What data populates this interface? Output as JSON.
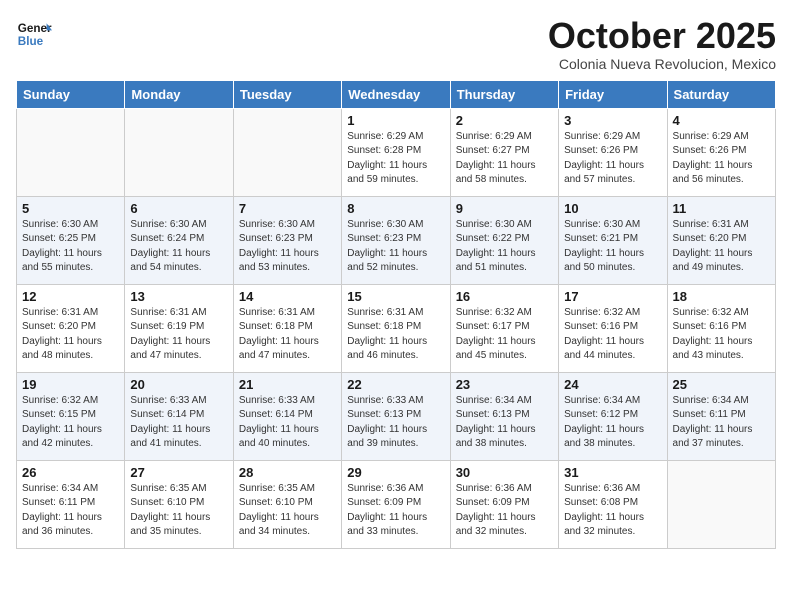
{
  "logo": {
    "line1": "General",
    "line2": "Blue"
  },
  "title": "October 2025",
  "subtitle": "Colonia Nueva Revolucion, Mexico",
  "days_of_week": [
    "Sunday",
    "Monday",
    "Tuesday",
    "Wednesday",
    "Thursday",
    "Friday",
    "Saturday"
  ],
  "weeks": [
    [
      {
        "day": "",
        "info": ""
      },
      {
        "day": "",
        "info": ""
      },
      {
        "day": "",
        "info": ""
      },
      {
        "day": "1",
        "info": "Sunrise: 6:29 AM\nSunset: 6:28 PM\nDaylight: 11 hours and 59 minutes."
      },
      {
        "day": "2",
        "info": "Sunrise: 6:29 AM\nSunset: 6:27 PM\nDaylight: 11 hours and 58 minutes."
      },
      {
        "day": "3",
        "info": "Sunrise: 6:29 AM\nSunset: 6:26 PM\nDaylight: 11 hours and 57 minutes."
      },
      {
        "day": "4",
        "info": "Sunrise: 6:29 AM\nSunset: 6:26 PM\nDaylight: 11 hours and 56 minutes."
      }
    ],
    [
      {
        "day": "5",
        "info": "Sunrise: 6:30 AM\nSunset: 6:25 PM\nDaylight: 11 hours and 55 minutes."
      },
      {
        "day": "6",
        "info": "Sunrise: 6:30 AM\nSunset: 6:24 PM\nDaylight: 11 hours and 54 minutes."
      },
      {
        "day": "7",
        "info": "Sunrise: 6:30 AM\nSunset: 6:23 PM\nDaylight: 11 hours and 53 minutes."
      },
      {
        "day": "8",
        "info": "Sunrise: 6:30 AM\nSunset: 6:23 PM\nDaylight: 11 hours and 52 minutes."
      },
      {
        "day": "9",
        "info": "Sunrise: 6:30 AM\nSunset: 6:22 PM\nDaylight: 11 hours and 51 minutes."
      },
      {
        "day": "10",
        "info": "Sunrise: 6:30 AM\nSunset: 6:21 PM\nDaylight: 11 hours and 50 minutes."
      },
      {
        "day": "11",
        "info": "Sunrise: 6:31 AM\nSunset: 6:20 PM\nDaylight: 11 hours and 49 minutes."
      }
    ],
    [
      {
        "day": "12",
        "info": "Sunrise: 6:31 AM\nSunset: 6:20 PM\nDaylight: 11 hours and 48 minutes."
      },
      {
        "day": "13",
        "info": "Sunrise: 6:31 AM\nSunset: 6:19 PM\nDaylight: 11 hours and 47 minutes."
      },
      {
        "day": "14",
        "info": "Sunrise: 6:31 AM\nSunset: 6:18 PM\nDaylight: 11 hours and 47 minutes."
      },
      {
        "day": "15",
        "info": "Sunrise: 6:31 AM\nSunset: 6:18 PM\nDaylight: 11 hours and 46 minutes."
      },
      {
        "day": "16",
        "info": "Sunrise: 6:32 AM\nSunset: 6:17 PM\nDaylight: 11 hours and 45 minutes."
      },
      {
        "day": "17",
        "info": "Sunrise: 6:32 AM\nSunset: 6:16 PM\nDaylight: 11 hours and 44 minutes."
      },
      {
        "day": "18",
        "info": "Sunrise: 6:32 AM\nSunset: 6:16 PM\nDaylight: 11 hours and 43 minutes."
      }
    ],
    [
      {
        "day": "19",
        "info": "Sunrise: 6:32 AM\nSunset: 6:15 PM\nDaylight: 11 hours and 42 minutes."
      },
      {
        "day": "20",
        "info": "Sunrise: 6:33 AM\nSunset: 6:14 PM\nDaylight: 11 hours and 41 minutes."
      },
      {
        "day": "21",
        "info": "Sunrise: 6:33 AM\nSunset: 6:14 PM\nDaylight: 11 hours and 40 minutes."
      },
      {
        "day": "22",
        "info": "Sunrise: 6:33 AM\nSunset: 6:13 PM\nDaylight: 11 hours and 39 minutes."
      },
      {
        "day": "23",
        "info": "Sunrise: 6:34 AM\nSunset: 6:13 PM\nDaylight: 11 hours and 38 minutes."
      },
      {
        "day": "24",
        "info": "Sunrise: 6:34 AM\nSunset: 6:12 PM\nDaylight: 11 hours and 38 minutes."
      },
      {
        "day": "25",
        "info": "Sunrise: 6:34 AM\nSunset: 6:11 PM\nDaylight: 11 hours and 37 minutes."
      }
    ],
    [
      {
        "day": "26",
        "info": "Sunrise: 6:34 AM\nSunset: 6:11 PM\nDaylight: 11 hours and 36 minutes."
      },
      {
        "day": "27",
        "info": "Sunrise: 6:35 AM\nSunset: 6:10 PM\nDaylight: 11 hours and 35 minutes."
      },
      {
        "day": "28",
        "info": "Sunrise: 6:35 AM\nSunset: 6:10 PM\nDaylight: 11 hours and 34 minutes."
      },
      {
        "day": "29",
        "info": "Sunrise: 6:36 AM\nSunset: 6:09 PM\nDaylight: 11 hours and 33 minutes."
      },
      {
        "day": "30",
        "info": "Sunrise: 6:36 AM\nSunset: 6:09 PM\nDaylight: 11 hours and 32 minutes."
      },
      {
        "day": "31",
        "info": "Sunrise: 6:36 AM\nSunset: 6:08 PM\nDaylight: 11 hours and 32 minutes."
      },
      {
        "day": "",
        "info": ""
      }
    ]
  ]
}
